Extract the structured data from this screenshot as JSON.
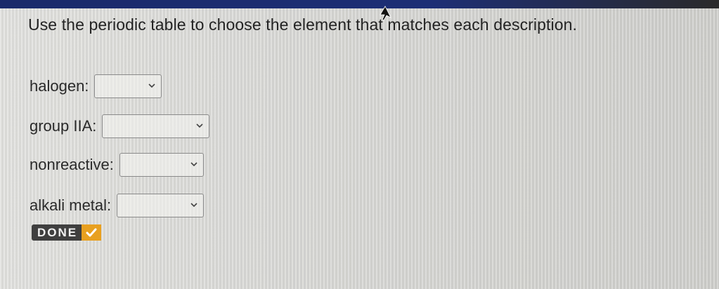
{
  "instructions": "Use the periodic table to choose the element that matches each description.",
  "questions": [
    {
      "label": "halogen:",
      "selected": ""
    },
    {
      "label": "group IIA:",
      "selected": ""
    },
    {
      "label": "nonreactive:",
      "selected": ""
    },
    {
      "label": "alkali metal:",
      "selected": ""
    }
  ],
  "done_button": {
    "label": "DONE",
    "icon": "checkmark-icon"
  },
  "colors": {
    "top_bar": "#1d2e75",
    "done_bg": "#3f3f3f",
    "check_accent": "#e8a020"
  }
}
